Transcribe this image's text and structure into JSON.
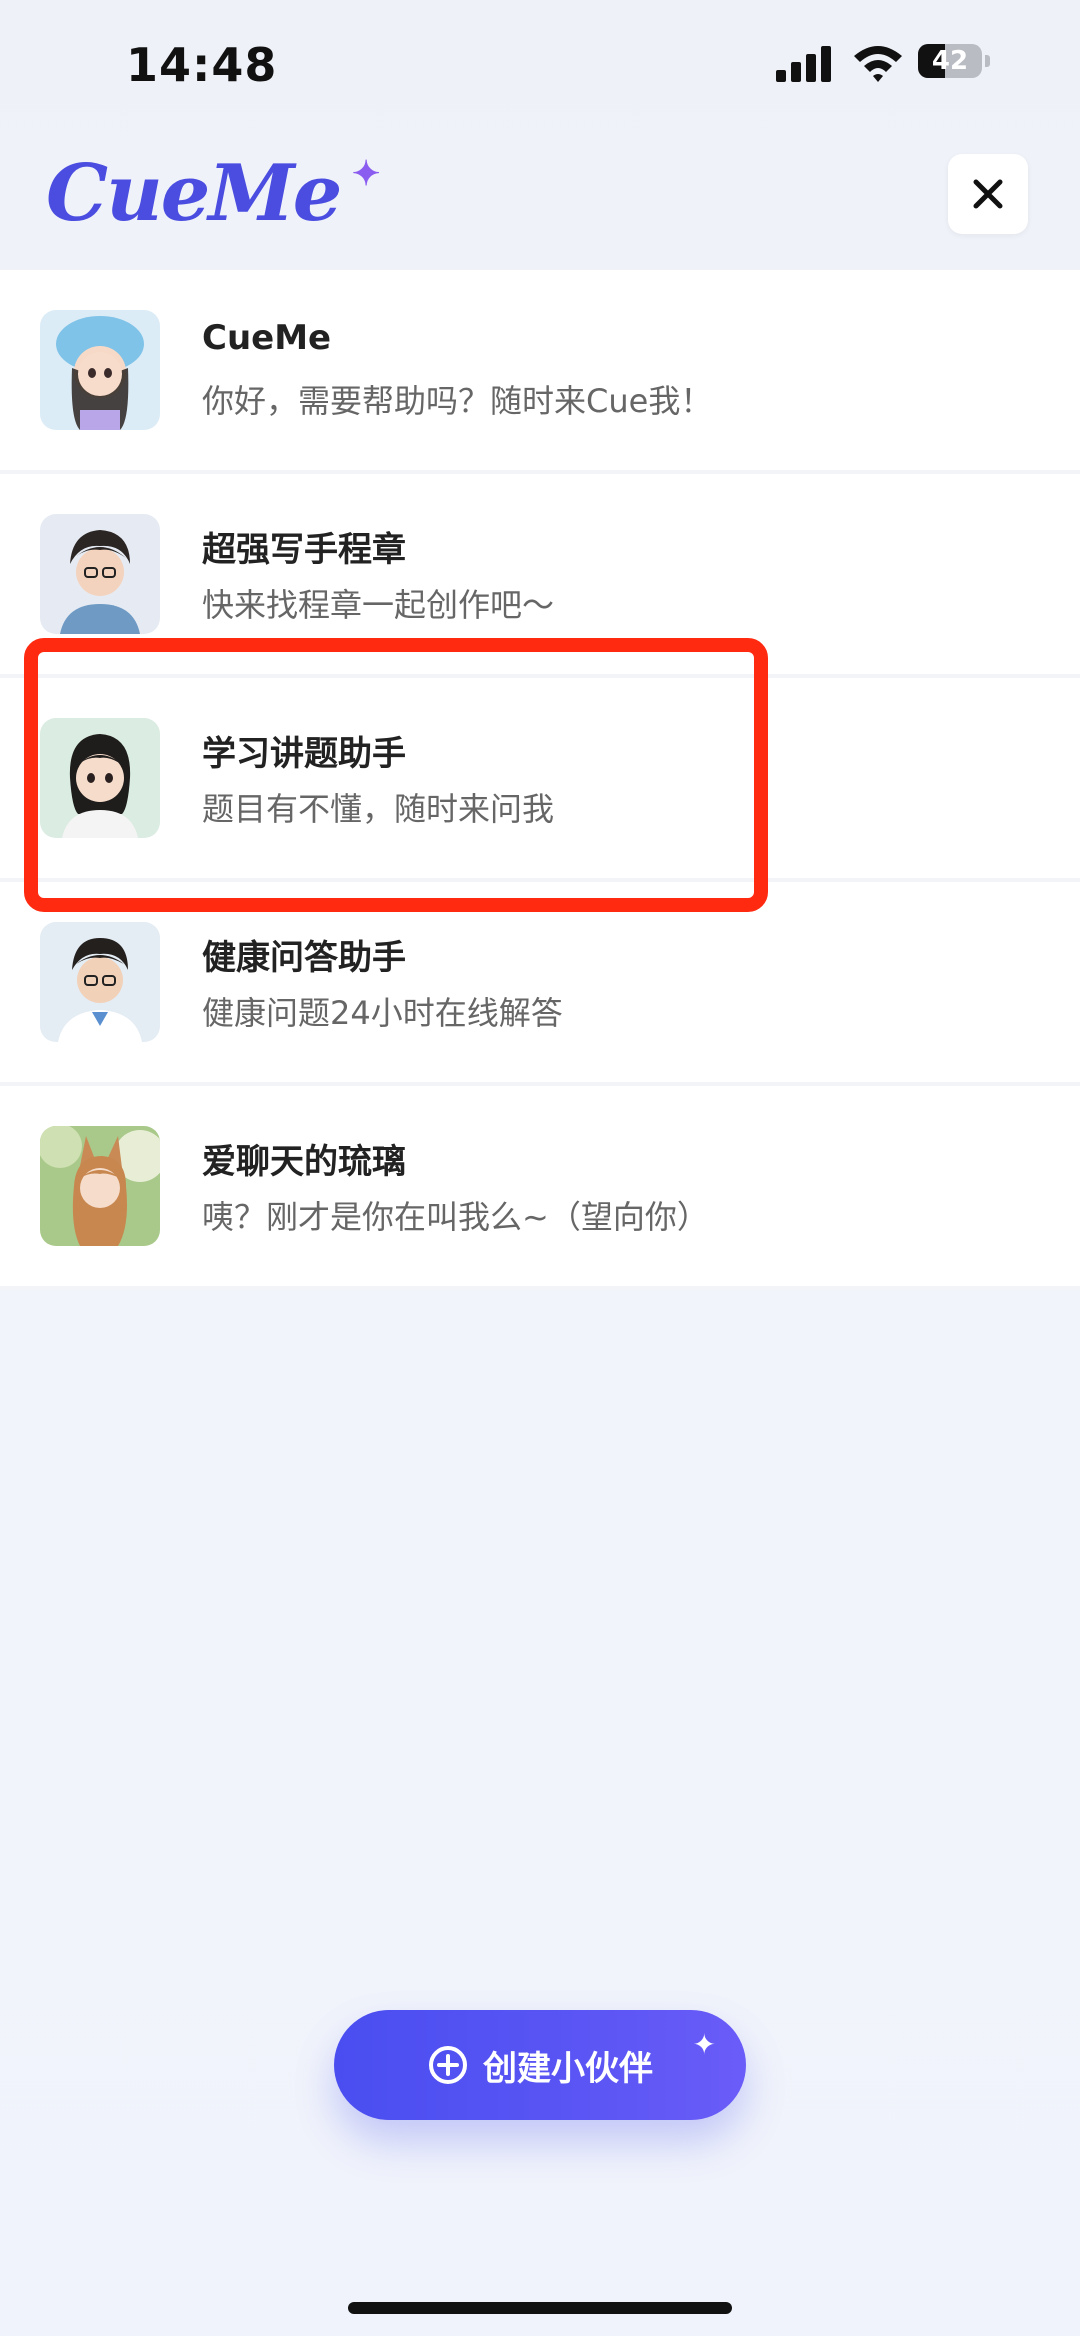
{
  "status": {
    "time": "14:48",
    "battery": "42",
    "battery_level": 0.42
  },
  "header": {
    "logo": "CueMe",
    "close_label": "✕"
  },
  "chats": [
    {
      "name": "CueMe",
      "desc": "你好，需要帮助吗？随时来Cue我！"
    },
    {
      "name": "超强写手程章",
      "desc": "快来找程章一起创作吧～"
    },
    {
      "name": "学习讲题助手",
      "desc": "题目有不懂，随时来问我"
    },
    {
      "name": "健康问答助手",
      "desc": "健康问题24小时在线解答"
    },
    {
      "name": "爱聊天的琉璃",
      "desc": "咦？刚才是你在叫我么~（望向你）"
    }
  ],
  "create_button": {
    "label": "创建小伙伴"
  },
  "colors": {
    "accent": "#4a4ef0",
    "highlight": "#ff2a10"
  }
}
